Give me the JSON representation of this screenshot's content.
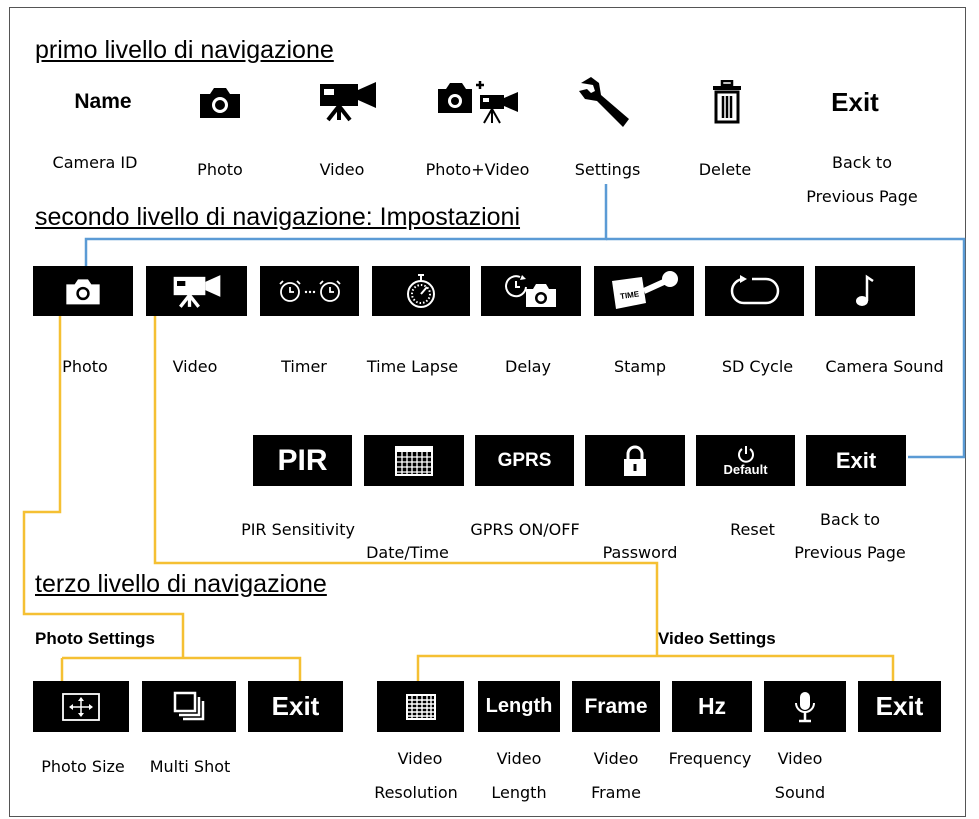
{
  "headings": {
    "level1": "primo livello di navigazione",
    "level2": "secondo livello di navigazione: Impostazioni",
    "level3": "terzo livello di navigazione"
  },
  "level1": {
    "name_icon_text": "Name",
    "exit_icon_text": "Exit",
    "labels": {
      "camera_id": "Camera ID",
      "photo": "Photo",
      "video": "Video",
      "photo_video": "Photo+Video",
      "settings": "Settings",
      "delete": "Delete",
      "back_1": "Back to",
      "back_2": "Previous Page"
    }
  },
  "level2": {
    "row1_labels": {
      "photo": "Photo",
      "video": "Video",
      "timer": "Timer",
      "time_lapse": "Time Lapse",
      "delay": "Delay",
      "stamp": "Stamp",
      "sd_cycle": "SD Cycle",
      "camera_sound": "Camera Sound"
    },
    "row2_tiles": {
      "pir": "PIR",
      "gprs": "GPRS",
      "default": "Default",
      "exit": "Exit",
      "stamp_time": "TIME"
    },
    "row2_labels": {
      "pir_sensitivity": "PIR Sensitivity",
      "date_time": "Date/Time",
      "gprs_onoff": "GPRS ON/OFF",
      "password": "Password",
      "reset": "Reset",
      "back_1": "Back to",
      "back_2": "Previous Page"
    }
  },
  "level3": {
    "photo_settings_title": "Photo Settings",
    "video_settings_title": "Video Settings",
    "photo_tiles": {
      "exit": "Exit"
    },
    "photo_labels": {
      "photo_size": "Photo Size",
      "multi_shot": "Multi Shot"
    },
    "video_tiles": {
      "length": "Length",
      "frame": "Frame",
      "hz": "Hz",
      "exit": "Exit"
    },
    "video_labels": {
      "resolution_1": "Video",
      "resolution_2": "Resolution",
      "length_1": "Video",
      "length_2": "Length",
      "frame_1": "Video",
      "frame_2": "Frame",
      "frequency": "Frequency",
      "sound_1": "Video",
      "sound_2": "Sound"
    }
  },
  "colors": {
    "blue_connector": "#5b9bd5",
    "orange_connector": "#f5c033",
    "tile": "#000000"
  },
  "icons": [
    "camera-icon",
    "video-camera-icon",
    "photo-video-icon",
    "wrench-icon",
    "trash-icon",
    "alarm-clock-icon",
    "stopwatch-icon",
    "delay-camera-icon",
    "stamp-icon",
    "cycle-icon",
    "music-note-icon",
    "calendar-grid-icon",
    "lock-icon",
    "power-icon",
    "resize-icon",
    "multi-shot-icon",
    "resolution-grid-icon",
    "microphone-icon"
  ]
}
